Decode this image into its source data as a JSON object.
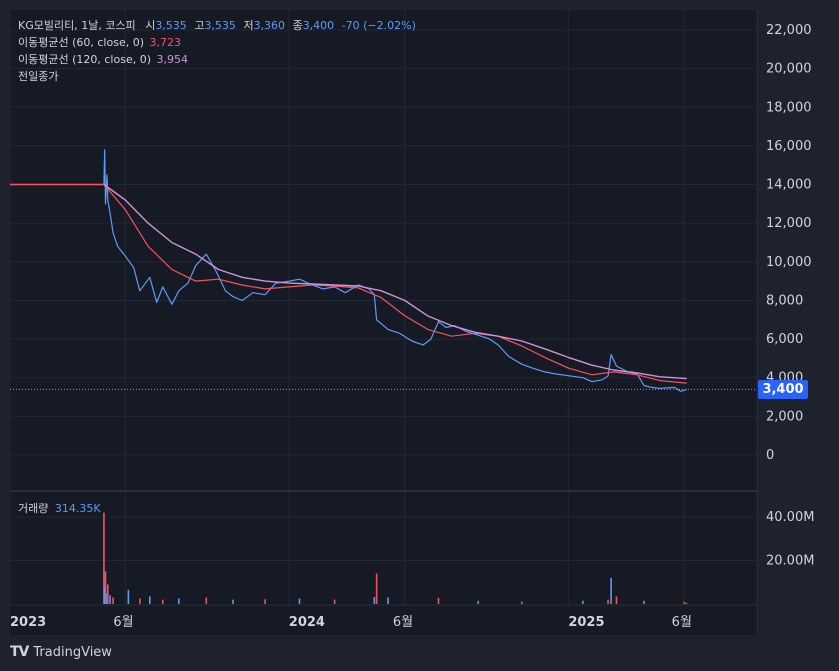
{
  "legend": {
    "symbol": "KG모빌리티, 1날, 코스피",
    "open_label": "시",
    "open_value": "3,535",
    "high_label": "고",
    "high_value": "3,535",
    "low_label": "저",
    "low_value": "3,360",
    "close_label": "종",
    "close_value": "3,400",
    "change": "-70 (−2.02%)",
    "ma60_label": "이동평균선 (60, close, 0)",
    "ma60_value": "3,723",
    "ma120_label": "이동평균선 (120, close, 0)",
    "ma120_value": "3,954",
    "prev_close_label": "전일종가"
  },
  "volume_legend": {
    "label": "거래량",
    "value": "314.35K"
  },
  "current_price_tag": "3,400",
  "branding": {
    "logo_text": "TV",
    "name": "TradingView"
  },
  "colors": {
    "background": "#1e222d",
    "up": "#f7525f",
    "down": "#5b9cf6",
    "ma60": "#f7525f",
    "ma120": "#ce93d8",
    "accent": "#2962ff"
  },
  "chart_data": {
    "type": "line",
    "price_axis": {
      "ylim": [
        0,
        22000
      ],
      "ticks": [
        0,
        2000,
        4000,
        6000,
        8000,
        10000,
        12000,
        14000,
        16000,
        18000,
        20000,
        22000
      ],
      "tick_labels": [
        "0",
        "2,000",
        "4,000",
        "6,000",
        "8,000",
        "10,000",
        "12,000",
        "14,000",
        "16,000",
        "18,000",
        "20,000",
        "22,000"
      ]
    },
    "volume_axis": {
      "ylim": [
        0,
        45000000
      ],
      "ticks": [
        20000000,
        40000000
      ],
      "tick_labels": [
        "20.00M",
        "40.00M"
      ]
    },
    "x_axis": {
      "range": [
        "2023-01-01",
        "2025-09-05"
      ],
      "ticks": [
        "2023-01-01",
        "2023-06-01",
        "2024-01-01",
        "2024-06-01",
        "2025-01-01",
        "2025-06-01"
      ],
      "tick_labels": [
        "2023",
        "6월",
        "2024",
        "6월",
        "2025",
        "6월"
      ]
    },
    "grid": true,
    "prev_close_line": 3400,
    "series": [
      {
        "name": "종가",
        "x": [
          "2023-01-01",
          "2023-05-04",
          "2023-05-05",
          "2023-05-06",
          "2023-05-08",
          "2023-05-09",
          "2023-05-12",
          "2023-05-16",
          "2023-05-22",
          "2023-06-01",
          "2023-06-12",
          "2023-06-20",
          "2023-07-03",
          "2023-07-12",
          "2023-07-20",
          "2023-08-01",
          "2023-08-10",
          "2023-08-22",
          "2023-09-01",
          "2023-09-15",
          "2023-09-28",
          "2023-10-10",
          "2023-10-20",
          "2023-11-01",
          "2023-11-15",
          "2023-12-01",
          "2023-12-15",
          "2024-01-02",
          "2024-01-15",
          "2024-02-01",
          "2024-02-15",
          "2024-03-01",
          "2024-03-15",
          "2024-04-01",
          "2024-04-15",
          "2024-04-22",
          "2024-04-25",
          "2024-05-10",
          "2024-05-25",
          "2024-06-10",
          "2024-06-25",
          "2024-07-05",
          "2024-07-15",
          "2024-07-25",
          "2024-08-05",
          "2024-08-20",
          "2024-09-05",
          "2024-09-20",
          "2024-10-01",
          "2024-10-15",
          "2024-11-01",
          "2024-11-15",
          "2024-12-01",
          "2024-12-15",
          "2025-01-02",
          "2025-01-20",
          "2025-02-01",
          "2025-02-15",
          "2025-02-22",
          "2025-02-26",
          "2025-03-05",
          "2025-03-20",
          "2025-04-01",
          "2025-04-10",
          "2025-04-20",
          "2025-05-01",
          "2025-05-20",
          "2025-05-28",
          "2025-06-02",
          "2025-06-05"
        ],
        "values": [
          14000,
          14000,
          15800,
          13000,
          14500,
          13200,
          12500,
          11500,
          10800,
          10300,
          9700,
          8500,
          9200,
          7900,
          8700,
          7800,
          8500,
          8900,
          9800,
          10400,
          9500,
          8500,
          8200,
          8000,
          8400,
          8300,
          8900,
          9000,
          9100,
          8800,
          8600,
          8700,
          8400,
          8800,
          8600,
          8300,
          7000,
          6500,
          6300,
          5900,
          5700,
          6000,
          6900,
          6600,
          6700,
          6400,
          6200,
          6000,
          5700,
          5100,
          4700,
          4500,
          4300,
          4200,
          4100,
          4000,
          3800,
          3900,
          4100,
          5200,
          4600,
          4300,
          4200,
          3600,
          3500,
          3450,
          3500,
          3300,
          3350,
          3400
        ]
      },
      {
        "name": "이동평균선 (60, close, 0)",
        "x": [
          "2023-01-01",
          "2023-05-04",
          "2023-06-01",
          "2023-07-01",
          "2023-08-01",
          "2023-09-01",
          "2023-10-01",
          "2023-11-01",
          "2023-12-01",
          "2024-01-01",
          "2024-02-01",
          "2024-03-01",
          "2024-04-01",
          "2024-05-01",
          "2024-06-01",
          "2024-07-01",
          "2024-08-01",
          "2024-09-01",
          "2024-10-01",
          "2024-11-01",
          "2024-12-01",
          "2025-01-01",
          "2025-02-01",
          "2025-03-01",
          "2025-04-01",
          "2025-05-01",
          "2025-06-05"
        ],
        "values": [
          14000,
          14000,
          12700,
          10800,
          9600,
          9000,
          9100,
          8800,
          8600,
          8700,
          8800,
          8750,
          8650,
          8150,
          7200,
          6500,
          6150,
          6300,
          6150,
          5650,
          5050,
          4500,
          4150,
          4300,
          4150,
          3850,
          3723
        ]
      },
      {
        "name": "이동평균선 (120, close, 0)",
        "x": [
          "2023-05-04",
          "2023-06-01",
          "2023-07-01",
          "2023-08-01",
          "2023-09-01",
          "2023-10-01",
          "2023-11-01",
          "2023-12-01",
          "2024-01-01",
          "2024-02-01",
          "2024-03-01",
          "2024-04-01",
          "2024-05-01",
          "2024-06-01",
          "2024-07-01",
          "2024-08-01",
          "2024-09-01",
          "2024-10-01",
          "2024-11-01",
          "2024-12-01",
          "2025-01-01",
          "2025-02-01",
          "2025-03-01",
          "2025-04-01",
          "2025-05-01",
          "2025-06-05"
        ],
        "values": [
          14000,
          13200,
          12000,
          11000,
          10400,
          9600,
          9200,
          9000,
          8900,
          8850,
          8800,
          8750,
          8500,
          8000,
          7200,
          6700,
          6350,
          6150,
          5900,
          5500,
          5050,
          4650,
          4400,
          4250,
          4050,
          3954
        ]
      }
    ],
    "volume": {
      "x": [
        "2023-05-04",
        "2023-05-05",
        "2023-05-06",
        "2023-05-08",
        "2023-05-09",
        "2023-05-12",
        "2023-05-16",
        "2023-06-05",
        "2023-06-20",
        "2023-07-03",
        "2023-07-20",
        "2023-08-10",
        "2023-09-15",
        "2023-10-20",
        "2023-12-01",
        "2024-01-15",
        "2024-03-01",
        "2024-04-22",
        "2024-04-25",
        "2024-05-10",
        "2024-07-15",
        "2024-09-05",
        "2024-11-01",
        "2025-01-20",
        "2025-02-22",
        "2025-02-26",
        "2025-03-05",
        "2025-04-10",
        "2025-06-02",
        "2025-06-05"
      ],
      "values": [
        42000000,
        8000000,
        15000000,
        5000000,
        9000000,
        4000000,
        3000000,
        6500000,
        2500000,
        3500000,
        2000000,
        2500000,
        3000000,
        2000000,
        2200000,
        2500000,
        2000000,
        3200000,
        14000000,
        3000000,
        2800000,
        1500000,
        1200000,
        1500000,
        2000000,
        12000000,
        3500000,
        1500000,
        1000000,
        314350
      ]
    }
  }
}
